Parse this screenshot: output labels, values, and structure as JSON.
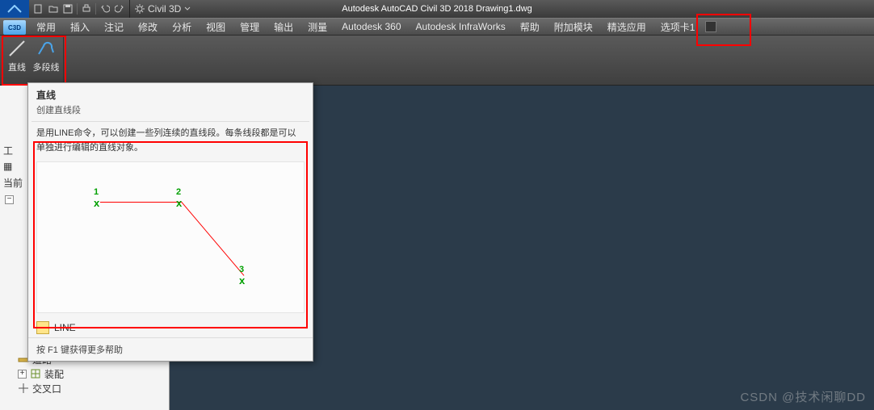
{
  "title_center": "Autodesk AutoCAD Civil 3D 2018     Drawing1.dwg",
  "app_icon_label": "C3D",
  "search_label": "Civil 3D",
  "menubar": {
    "items": [
      "常用",
      "插入",
      "注记",
      "修改",
      "分析",
      "视图",
      "管理",
      "输出",
      "测量",
      "Autodesk 360",
      "Autodesk InfraWorks",
      "帮助",
      "附加模块",
      "精选应用",
      "选项卡1"
    ]
  },
  "ribbon": {
    "line_label": "直线",
    "polyline_label": "多段线"
  },
  "tooltip": {
    "title": "直线",
    "sub": "创建直线段",
    "desc": "是用LINE命令，可以创建一些列连续的直线段。每条线段都是可以单独进行编辑的直线对象。",
    "cmd": "LINE",
    "help": "按 F1 键获得更多帮助"
  },
  "left_panel": {
    "toolbox_label": "工",
    "current_label": "当前",
    "tree": {
      "road": "道路",
      "assembly": "装配",
      "intersection": "交叉口"
    }
  },
  "watermark": "CSDN @技术闲聊DD",
  "preview_points": {
    "p1": "1",
    "p2": "2",
    "p3": "3",
    "marker": "x"
  }
}
